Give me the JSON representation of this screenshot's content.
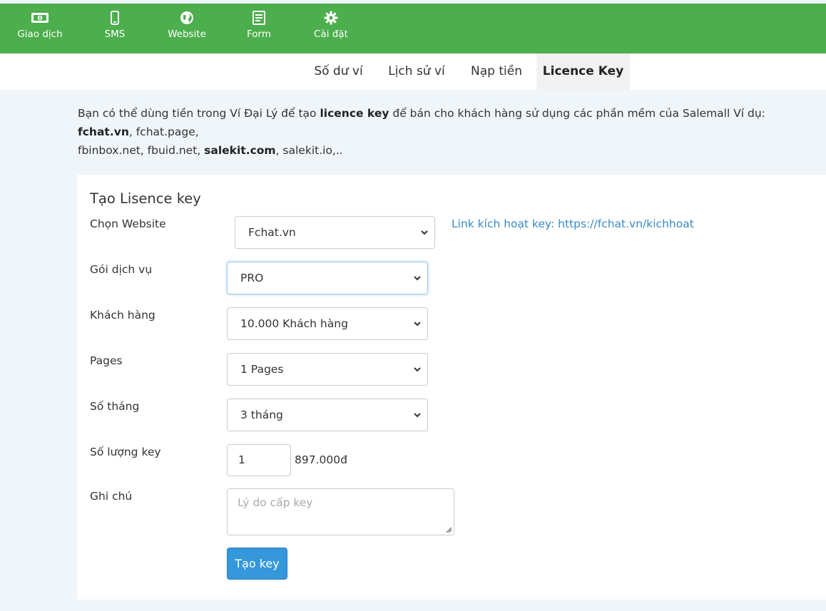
{
  "topnav": {
    "items": [
      {
        "label": "Giao dịch",
        "icon": "money-icon"
      },
      {
        "label": "SMS",
        "icon": "mobile-icon"
      },
      {
        "label": "Website",
        "icon": "globe-icon"
      },
      {
        "label": "Form",
        "icon": "form-icon"
      },
      {
        "label": "Cài đặt",
        "icon": "gear-icon"
      }
    ],
    "color": "#4cae4c"
  },
  "tabs": [
    {
      "label": "Số dư ví"
    },
    {
      "label": "Lịch sử ví"
    },
    {
      "label": "Nạp tiền"
    },
    {
      "label": "Licence Key",
      "active": true
    }
  ],
  "intro": {
    "p1": "Bạn có thể dùng tiền trong Ví Đại Lý để tạo ",
    "b1": "licence key",
    "p2": " để bán cho khách hàng sử dụng các phần mềm của Salemall Ví dụ: ",
    "b2": "fchat.vn",
    "p3": ", fchat.page,",
    "p4": "fbinbox.net, fbuid.net, ",
    "b3": "salekit.com",
    "p5": ", salekit.io,.."
  },
  "form": {
    "title": "Tạo Lisence key",
    "website": {
      "label": "Chọn Website",
      "value": "Fchat.vn"
    },
    "activation_link": "Link kích hoạt key: https://fchat.vn/kichhoat",
    "package": {
      "label": "Gói dịch vụ",
      "value": "PRO"
    },
    "customers": {
      "label": "Khách hàng",
      "value": "10.000 Khách hàng"
    },
    "pages": {
      "label": "Pages",
      "value": "1 Pages"
    },
    "months": {
      "label": "Số tháng",
      "value": "3 tháng"
    },
    "quantity": {
      "label": "Số lượng key",
      "value": "1",
      "price": "897.000đ"
    },
    "note": {
      "label": "Ghi chú",
      "placeholder": "Lý do cấp key"
    },
    "submit_label": "Tạo key"
  },
  "colors": {
    "accent": "#3498db",
    "link": "#3b8ac4"
  }
}
